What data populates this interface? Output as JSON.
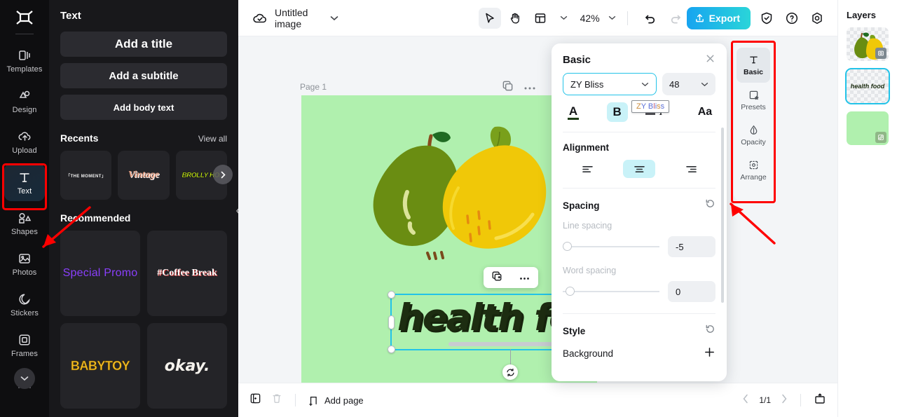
{
  "rail": {
    "logo_icon": "capcut-logo-icon",
    "items": [
      {
        "label": "Templates",
        "icon": "templates-icon"
      },
      {
        "label": "Design",
        "icon": "design-icon"
      },
      {
        "label": "Upload",
        "icon": "upload-cloud-icon"
      },
      {
        "label": "Text",
        "icon": "text-T-icon",
        "active": true
      },
      {
        "label": "Shapes",
        "icon": "shapes-icon"
      },
      {
        "label": "Photos",
        "icon": "photos-image-icon"
      },
      {
        "label": "Stickers",
        "icon": "stickers-icon"
      },
      {
        "label": "Frames",
        "icon": "frames-icon"
      }
    ],
    "more_label": "chevron-down-icon"
  },
  "text_panel": {
    "title": "Text",
    "buttons": [
      {
        "label": "Add a title"
      },
      {
        "label": "Add a subtitle"
      },
      {
        "label": "Add body text"
      }
    ],
    "recents": {
      "heading": "Recents",
      "view_all": "View all",
      "items": [
        {
          "label": "「THE MOMENT」"
        },
        {
          "label": "Vintage"
        },
        {
          "label": "BROLLY HO."
        }
      ],
      "next_icon": "chevron-right-icon"
    },
    "recommended": {
      "heading": "Recommended",
      "items": [
        {
          "label": "Special Promo"
        },
        {
          "label": "#Coffee Break"
        },
        {
          "label": "BABYTOY"
        },
        {
          "label": "okay."
        }
      ]
    },
    "collapse_icon": "chevron-left-icon"
  },
  "topbar": {
    "cloud_icon": "cloud-saved-icon",
    "doc_title": "Untitled image",
    "title_caret": "chevron-down-icon",
    "tools": [
      {
        "name": "select-tool",
        "icon": "cursor-arrow-icon",
        "selected": true
      },
      {
        "name": "hand-tool",
        "icon": "hand-icon",
        "selected": false
      },
      {
        "name": "layout-tool",
        "icon": "layout-grid-icon",
        "selected": false
      }
    ],
    "layout_caret": "chevron-down-icon",
    "zoom_value": "42%",
    "zoom_caret": "chevron-down-icon",
    "undo_icon": "undo-arrow-icon",
    "redo_icon": "redo-arrow-icon",
    "export_label": "Export",
    "export_icon": "export-upload-icon",
    "export_gradient_from": "#17a4f0",
    "export_gradient_to": "#2ad5d9",
    "shield_icon": "shield-check-icon",
    "help_icon": "question-circle-icon",
    "settings_icon": "gear-icon"
  },
  "canvas": {
    "page_label": "Page 1",
    "duplicate_icon": "duplicate-page-icon",
    "more_icon": "more-dots-icon",
    "background_color": "#b0f0ae",
    "artwork_alt": "pear-and-lemon-illustration",
    "float_toolbar": {
      "duplicate_icon": "duplicate-icon",
      "more_icon": "more-dots-icon"
    },
    "selected_text": "health food",
    "selection_color": "#23c3e8",
    "rotate_icon": "rotate-icon"
  },
  "props": {
    "title": "Basic",
    "close_icon": "close-icon",
    "font_name": "ZY Bliss",
    "font_caret": "chevron-down-icon",
    "font_size": "48",
    "size_caret": "chevron-down-icon",
    "style_buttons": [
      {
        "name": "text-color-button",
        "glyph": "A",
        "active": false,
        "swatch": "#1d3b17"
      },
      {
        "name": "bold-button",
        "glyph": "B",
        "active": true
      },
      {
        "name": "italic-button",
        "glyph": "I",
        "active": false
      },
      {
        "name": "case-button",
        "glyph": "Aa",
        "active": false
      }
    ],
    "font_tooltip": "ZY Bliss",
    "alignment": {
      "label": "Alignment",
      "options": [
        {
          "name": "align-left",
          "active": false
        },
        {
          "name": "align-center",
          "active": true
        },
        {
          "name": "align-right",
          "active": false
        }
      ]
    },
    "spacing": {
      "label": "Spacing",
      "reset_icon": "reset-icon",
      "line_spacing_label": "Line spacing",
      "line_spacing_value": "-5",
      "word_spacing_label": "Word spacing",
      "word_spacing_value": "0"
    },
    "style": {
      "label": "Style",
      "reset_icon": "reset-icon",
      "background_label": "Background",
      "add_icon": "plus-icon"
    }
  },
  "tabstrip": {
    "tabs": [
      {
        "label": "Basic",
        "icon": "text-T-icon",
        "active": true
      },
      {
        "label": "Presets",
        "icon": "presets-star-icon",
        "active": false
      },
      {
        "label": "Opacity",
        "icon": "opacity-drop-icon",
        "active": false
      },
      {
        "label": "Arrange",
        "icon": "arrange-icon",
        "active": false
      }
    ],
    "highlight_color": "#ff0000"
  },
  "layers": {
    "title": "Layers",
    "items": [
      {
        "name": "layer-fruits",
        "type": "image",
        "selected": false,
        "badge": "image-badge-icon"
      },
      {
        "name": "layer-text",
        "type": "text",
        "selected": true,
        "text": "health food"
      },
      {
        "name": "layer-background",
        "type": "background",
        "selected": false,
        "badge": "background-badge-icon",
        "color": "#b0f0ae"
      }
    ]
  },
  "bottombar": {
    "duplicate_icon": "duplicate-page-icon",
    "delete_icon": "trash-icon",
    "add_page_label": "Add page",
    "add_page_icon": "add-page-icon",
    "prev_icon": "chevron-left-icon",
    "page_indicator": "1/1",
    "next_icon": "chevron-right-icon",
    "present_icon": "present-icon"
  }
}
